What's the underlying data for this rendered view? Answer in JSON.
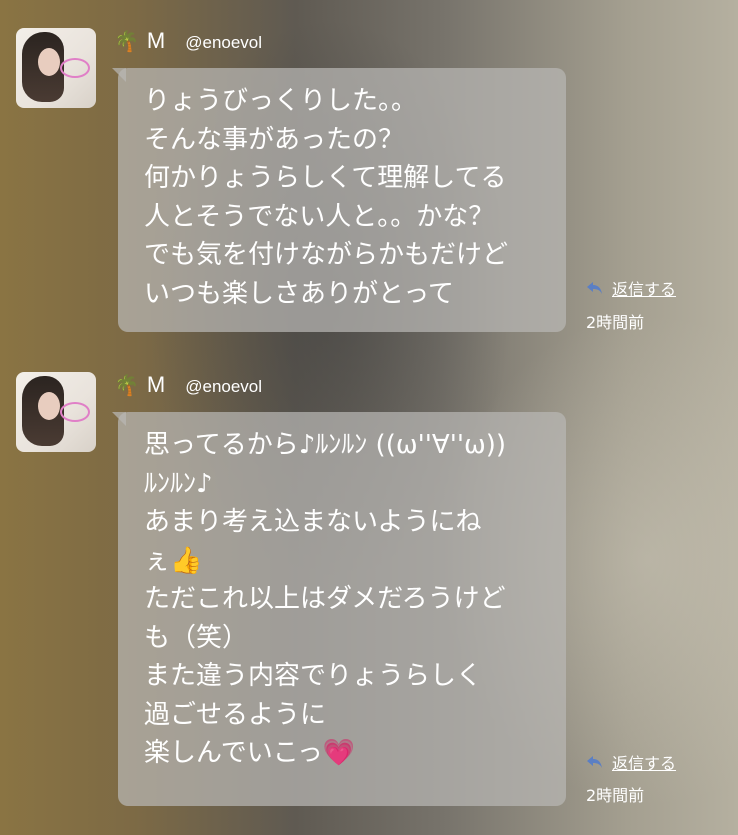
{
  "messages": [
    {
      "user": {
        "palm_icon": "🌴",
        "name": "M",
        "handle": "@enoevol"
      },
      "lines": [
        "りょうびっくりした。。",
        "そんな事があったの？",
        "何かりょうらしくて理解してる",
        "人とそうでない人と。。かな？",
        "でも気を付けながらかもだけど",
        "いつも楽しさありがとって"
      ],
      "reply_label": "返信する",
      "time": "2時間前"
    },
    {
      "user": {
        "palm_icon": "🌴",
        "name": "M",
        "handle": "@enoevol"
      },
      "lines": [
        "思ってるから♪ﾙﾝﾙﾝ ((ω''∀''ω))",
        "ﾙﾝﾙﾝ♪",
        "あまり考え込まないようにね",
        "ぇ👍",
        "ただこれ以上はダメだろうけど",
        "も（笑）",
        "また違う内容でりょうらしく",
        "過ごせるように",
        "楽しんでいこっ💗"
      ],
      "reply_label": "返信する",
      "time": "2時間前"
    }
  ],
  "colors": {
    "bubble": "#b9b7b4",
    "reply_icon": "#5b7fc4",
    "text": "#ffffff"
  }
}
